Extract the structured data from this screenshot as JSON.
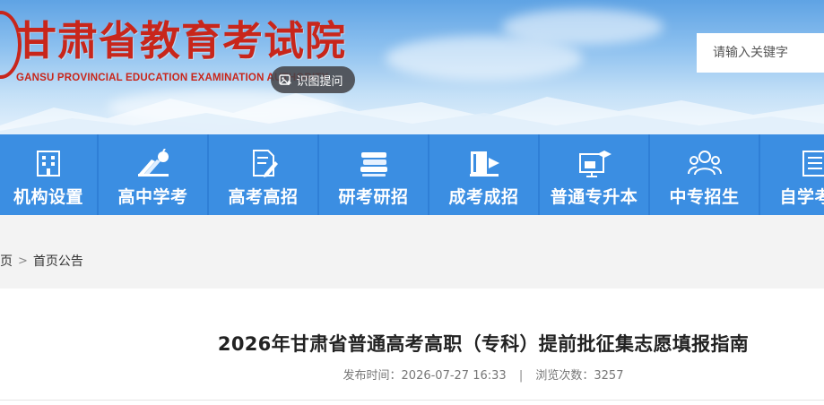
{
  "header": {
    "title": "甘肃省教育考试院",
    "subtitle": "GANSU PROVINCIAL EDUCATION EXAMINATION AUTHORITY",
    "ocr_badge_label": "识图提问",
    "title_color": "#c8261b"
  },
  "search": {
    "placeholder": "请输入关键字",
    "value": ""
  },
  "nav": {
    "background": "#3b8ee2",
    "items": [
      {
        "label": "机构设置",
        "icon": "building-icon"
      },
      {
        "label": "高中学考",
        "icon": "books-apple-icon"
      },
      {
        "label": "高考高招",
        "icon": "exam-paper-pen-icon"
      },
      {
        "label": "研考研招",
        "icon": "book-stack-icon"
      },
      {
        "label": "成考成招",
        "icon": "book-flag-icon"
      },
      {
        "label": "普通专升本",
        "icon": "graduation-board-icon"
      },
      {
        "label": "中专招生",
        "icon": "people-group-icon"
      },
      {
        "label": "自学考试",
        "icon": "document-list-icon"
      }
    ]
  },
  "breadcrumb": {
    "home": "主页",
    "separator": ">",
    "current": "首页公告"
  },
  "article": {
    "title": "2026年甘肃省普通高考高职（专科）提前批征集志愿填报指南",
    "publish_label": "发布时间：",
    "publish_time": "2026-07-27 16:33",
    "meta_separator": "|",
    "views_label": "浏览次数：",
    "views": "3257"
  }
}
